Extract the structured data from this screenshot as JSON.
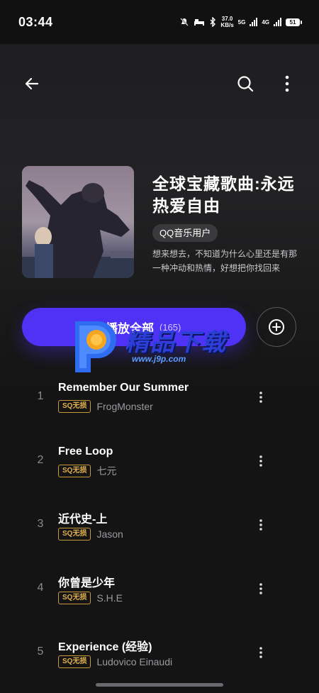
{
  "status": {
    "time": "03:44",
    "net_speed_top": "37.0",
    "net_speed_unit": "KB/s",
    "net1": "5G",
    "net2": "4G",
    "battery": "51"
  },
  "nav": {
    "back_icon": "back-arrow-icon",
    "search_icon": "search-icon",
    "more_icon": "more-vertical-icon"
  },
  "playlist": {
    "title": "全球宝藏歌曲:永远热爱自由",
    "creator": "QQ音乐用户",
    "description": "想来想去，不知道为什么心里还是有那一种冲动和热情，好想把你找回来"
  },
  "actions": {
    "play_all_label": "播放全部",
    "play_all_count": "(165)",
    "add_icon": "plus-circle-icon"
  },
  "watermark": {
    "text": "精品下载",
    "url": "www.j9p.com"
  },
  "songs": [
    {
      "index": "1",
      "title": "Remember Our Summer",
      "quality": "SQ无损",
      "artist": "FrogMonster"
    },
    {
      "index": "2",
      "title": "Free Loop",
      "quality": "SQ无损",
      "artist": "七元"
    },
    {
      "index": "3",
      "title": "近代史-上",
      "quality": "SQ无损",
      "artist": "Jason"
    },
    {
      "index": "4",
      "title": "你曾是少年",
      "quality": "SQ无损",
      "artist": "S.H.E"
    },
    {
      "index": "5",
      "title": "Experience (经验)",
      "quality": "SQ无损",
      "artist": "Ludovico Einaudi"
    }
  ],
  "colors": {
    "accent": "#4e32f6",
    "badge": "#e0b050",
    "background": "#141414"
  }
}
